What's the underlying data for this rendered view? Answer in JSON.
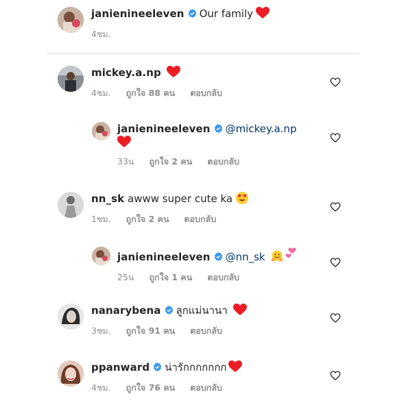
{
  "caption": {
    "username": "janienineeleven",
    "text": "Our family",
    "time": "4ชม."
  },
  "comments": [
    {
      "username": "mickey.a.np",
      "text": "",
      "mention": "",
      "time": "4ชม.",
      "likes": "ถูกใจ 88 คน",
      "reply": "ตอบกลับ",
      "verified": false,
      "emojis": [
        "red-heart"
      ]
    },
    {
      "username": "janienineeleven",
      "text": "",
      "mention": "@mickey.a.np",
      "time": "33น",
      "likes": "ถูกใจ 2 คน",
      "reply": "ตอบกลับ",
      "verified": true,
      "emojis": [
        "red-heart"
      ],
      "is_reply": true
    },
    {
      "username": "nn_sk",
      "text": "awww super cute ka",
      "mention": "",
      "time": "1ชม.",
      "likes": "ถูกใจ 2 คน",
      "reply": "ตอบกลับ",
      "verified": false,
      "emojis": [
        "heart-eyes"
      ]
    },
    {
      "username": "janienineeleven",
      "text": "",
      "mention": "@nn_sk",
      "time": "25น",
      "likes": "ถูกใจ 1 คน",
      "reply": "ตอบกลับ",
      "verified": true,
      "emojis": [
        "hugging-face",
        "two-hearts"
      ],
      "is_reply": true
    },
    {
      "username": "nanarybena",
      "text": "ลูกแม่นานา",
      "mention": "",
      "time": "3ชม.",
      "likes": "ถูกใจ 91 คน",
      "reply": "ตอบกลับ",
      "verified": true,
      "emojis": [
        "red-heart"
      ]
    },
    {
      "username": "ppanward",
      "text": "น่ารักกกกกกก",
      "mention": "",
      "time": "4ชม.",
      "likes": "ถูกใจ 76 คน",
      "reply": "ตอบกลับ",
      "verified": true,
      "emojis": [
        "red-heart"
      ]
    }
  ],
  "colors": {
    "verified": "#3897f0",
    "heart": "#ed1c24",
    "meta": "#8e8e8e",
    "mention": "#00376b",
    "divider": "#dbdbdb"
  },
  "icons": {
    "verified": "verified-badge-icon",
    "like": "heart-outline-icon"
  }
}
